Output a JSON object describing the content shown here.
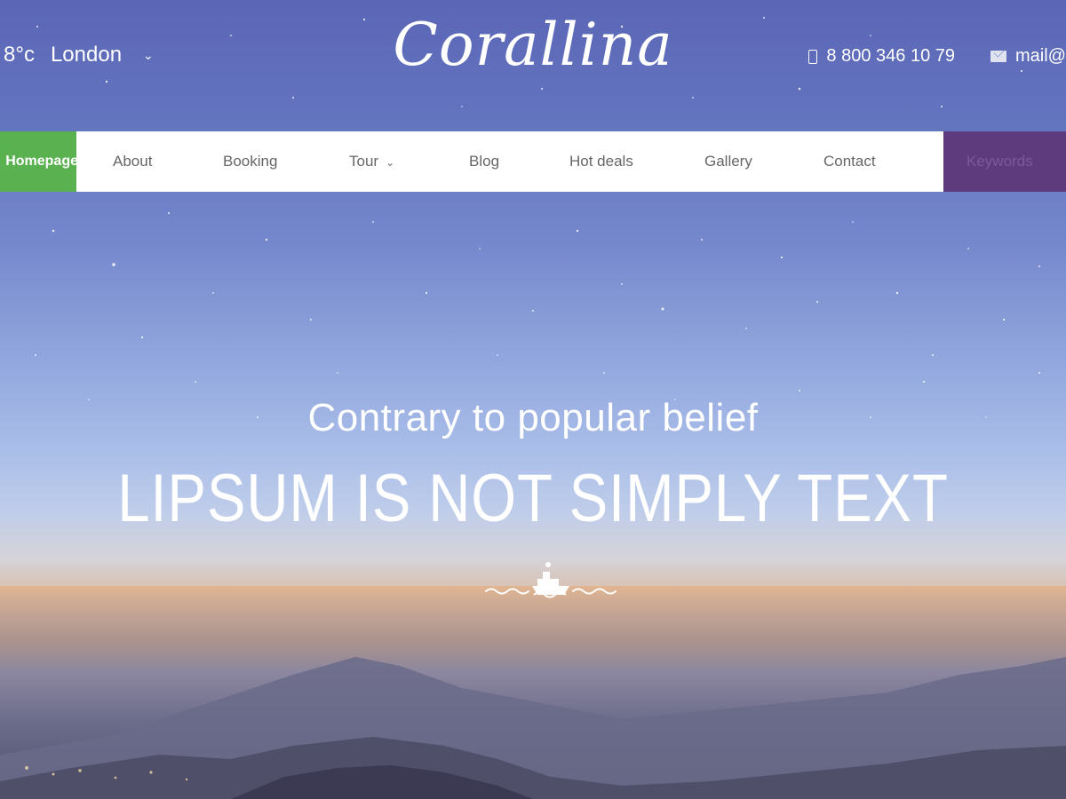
{
  "weather": {
    "temperature": "8°c",
    "city": "London"
  },
  "logo": "Corallina",
  "contact": {
    "phone": "8 800 346 10 79",
    "email": "mail@"
  },
  "nav": {
    "home_label": "Homepage",
    "items": [
      "About",
      "Booking",
      "Tour",
      "Blog",
      "Hot deals",
      "Gallery",
      "Contact"
    ],
    "search_placeholder": "Keywords"
  },
  "hero": {
    "subtitle": "Contrary to popular belief",
    "title": "LIPSUM IS NOT SIMPLY TEXT"
  },
  "colors": {
    "home_green": "#5ab150",
    "search_purple": "#5d3b7c",
    "nav_bg": "#ffffff"
  },
  "icons": [
    "chevron-down-icon",
    "phone-icon",
    "mail-icon",
    "ship-icon"
  ]
}
